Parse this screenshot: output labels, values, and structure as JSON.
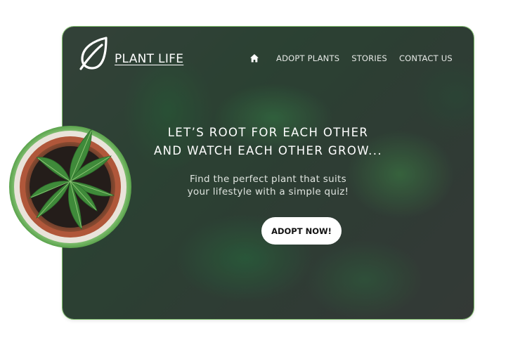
{
  "brand": {
    "name": "PLANT LIFE",
    "logo_icon": "leaf-icon"
  },
  "nav": {
    "home_icon": "home-icon",
    "items": [
      {
        "label": "ADOPT PLANTS"
      },
      {
        "label": "STORIES"
      },
      {
        "label": "CONTACT US"
      }
    ]
  },
  "hero": {
    "headline_line1": "LET’S ROOT FOR EACH OTHER",
    "headline_line2": "AND WATCH EACH OTHER GROW...",
    "subtext_line1": "Find the perfect plant that suits",
    "subtext_line2": "your lifestyle with a simple quiz!",
    "cta_label": "ADOPT NOW!"
  },
  "colors": {
    "accent_green": "#7fbf6a",
    "hero_dark": "#34433a",
    "text_white": "#ffffff"
  }
}
